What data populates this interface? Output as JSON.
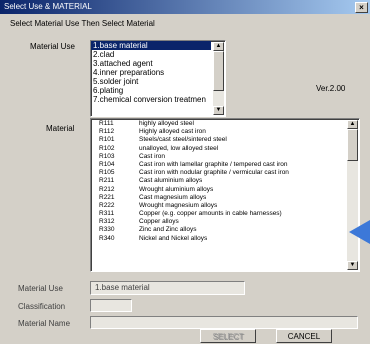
{
  "window": {
    "title": "Select Use & MATERIAL",
    "close_label": "×"
  },
  "instruction": "Select Material Use Then Select Material",
  "material_use_label": "Material Use",
  "material_use_list": [
    "1.base material",
    "2.clad",
    "3.attached agent",
    "4.inner preparations",
    "5.solder joint",
    "6.plating",
    "7.chemical conversion treatmen"
  ],
  "version": "Ver.2.00",
  "material_label": "Material",
  "material_list": [
    {
      "code": "R111",
      "desc": "highly alloyed steel"
    },
    {
      "code": "R112",
      "desc": "Highly alloyed cast iron"
    },
    {
      "code": "R101",
      "desc": "Steels/cast steel/sintered steel"
    },
    {
      "code": "R102",
      "desc": "unalloyed, low alloyed steel"
    },
    {
      "code": "R103",
      "desc": "Cast iron"
    },
    {
      "code": "R104",
      "desc": "Cast iron with lamellar graphite / tempered cast iron"
    },
    {
      "code": "R105",
      "desc": "Cast iron with nodular graphite / vermicular cast iron"
    },
    {
      "code": "R211",
      "desc": "Cast aluminium alloys"
    },
    {
      "code": "R212",
      "desc": "Wrought aluminium alloys"
    },
    {
      "code": "R221",
      "desc": "Cast magnesium alloys"
    },
    {
      "code": "R222",
      "desc": "Wrought magnesium alloys"
    },
    {
      "code": "R311",
      "desc": "Copper (e.g. copper amounts in cable harnesses)"
    },
    {
      "code": "R312",
      "desc": "Copper alloys"
    },
    {
      "code": "R330",
      "desc": "Zinc and Zinc alloys"
    },
    {
      "code": "R340",
      "desc": "Nickel and Nickel alloys"
    }
  ],
  "bottom": {
    "material_use_label": "Material Use",
    "material_use_value": "1.base material",
    "classification_label": "Classification",
    "classification_value": "",
    "material_name_label": "Material Name",
    "material_name_value": ""
  },
  "buttons": {
    "select": "SELECT",
    "cancel": "CANCEL"
  },
  "colors": {
    "title_bar": "#0a246a",
    "selection": "#0a246a",
    "pointer": "#3c78d8"
  }
}
